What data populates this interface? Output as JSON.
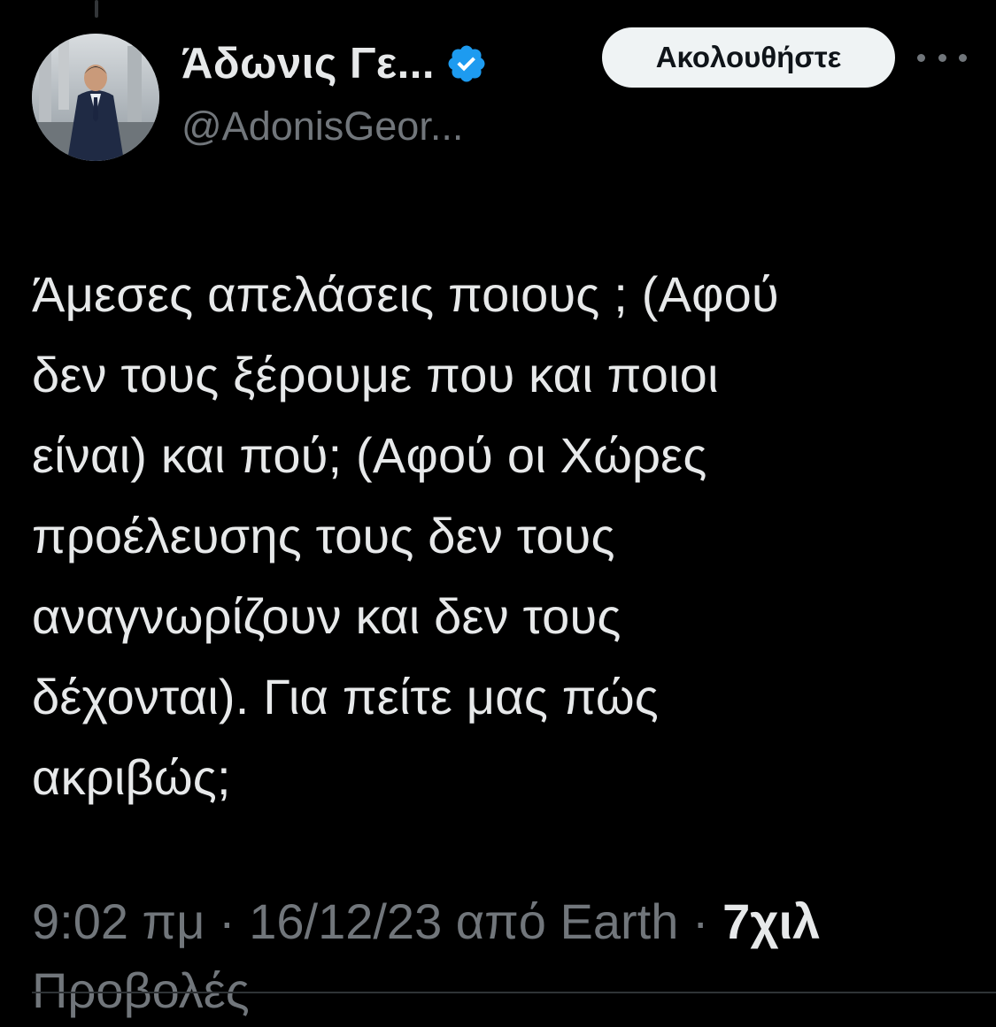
{
  "author": {
    "display_name": "Άδωνις Γε...",
    "handle": "@AdonisGeor...",
    "verified": true,
    "verified_color": "#1d9bf0"
  },
  "actions": {
    "follow_label": "Ακολουθήστε",
    "more_icon": "more-horizontal-icon"
  },
  "tweet": {
    "lines": [
      "Άμεσες απελάσεις ποιους ; (Αφού",
      "δεν τους ξέρουμε που και ποιοι",
      "είναι) και πού; (Αφού οι Χώρες",
      "προέλευσης τους δεν τους",
      "αναγνωρίζουν και δεν τους",
      "δέχονται). Για πείτε μας πώς",
      "ακριβώς;"
    ]
  },
  "meta": {
    "time": "9:02 πμ",
    "separator": "·",
    "date": "16/12/23",
    "source_prefix": "από",
    "source": "Earth",
    "views_count": "7χιλ",
    "views_label": "Προβολές"
  },
  "colors": {
    "background": "#000000",
    "primary_text": "#e7e9ea",
    "secondary_text": "#71767b",
    "follow_button_bg": "#eff3f4",
    "divider": "#2f3336"
  }
}
